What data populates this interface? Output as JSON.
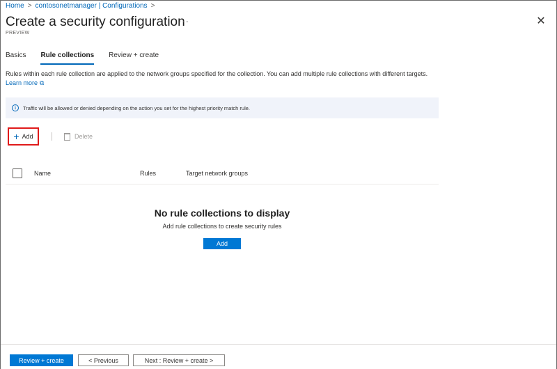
{
  "breadcrumb": {
    "items": [
      "Home",
      "contosonetmanager | Configurations"
    ],
    "separator": ">"
  },
  "page": {
    "title": "Create a security configuration",
    "more_label": "···",
    "subtitle": "PREVIEW",
    "close_label": "✕"
  },
  "tabs": [
    {
      "label": "Basics",
      "active": false
    },
    {
      "label": "Rule collections",
      "active": true
    },
    {
      "label": "Review + create",
      "active": false
    }
  ],
  "description": {
    "text": "Rules within each rule collection are applied to the network groups specified for the collection. You can add multiple rule collections with different targets.",
    "learn_more": "Learn more",
    "external_glyph": "⧉"
  },
  "info": {
    "icon_glyph": "i",
    "text": "Traffic will be allowed or denied depending on the action you set for the highest priority match rule."
  },
  "toolbar": {
    "add_label": "Add",
    "add_glyph": "+",
    "delete_label": "Delete"
  },
  "table": {
    "columns": [
      "Name",
      "Rules",
      "Target network groups"
    ]
  },
  "empty_state": {
    "title": "No rule collections to display",
    "subtitle": "Add rule collections to create security rules",
    "button_label": "Add"
  },
  "footer": {
    "primary_label": "Review + create",
    "previous_label": "< Previous",
    "next_label": "Next : Review + create >"
  },
  "colors": {
    "accent": "#0078d4",
    "link": "#0067b8",
    "highlight_border": "#e01a1a",
    "info_background": "#f0f3fa"
  }
}
